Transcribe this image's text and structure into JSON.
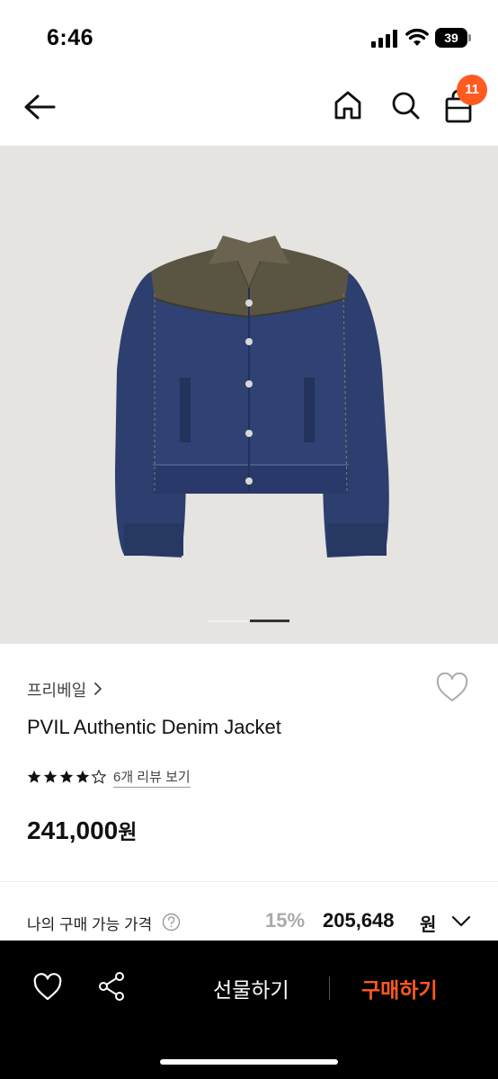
{
  "status_bar": {
    "time": "6:46",
    "battery": "39",
    "icons": [
      "cellular-signal-icon",
      "wifi-icon",
      "battery-icon"
    ]
  },
  "nav": {
    "icons": [
      "back-arrow-icon",
      "home-icon",
      "search-icon",
      "shopping-bag-icon"
    ],
    "cart_count": "11"
  },
  "hero": {
    "image": "denim-jacket-photo",
    "slide_index": 2,
    "slide_total": 2
  },
  "product": {
    "brand": "프리베일",
    "name": "PVIL Authentic Denim Jacket",
    "rating": 4.5,
    "rating_max": 5,
    "review_link": "6개 리뷰 보기",
    "price": "241,000",
    "price_unit": "원"
  },
  "my_price": {
    "label": "나의 구매 가능 가격",
    "discount": "15%",
    "price": "205,648",
    "unit": "원"
  },
  "bottom_bar": {
    "gift_label": "선물하기",
    "buy_label": "구매하기"
  },
  "colors": {
    "accent": "#ff5a1f",
    "bottom_bar_bg": "#000000",
    "hero_bg": "#e5e4e0",
    "discount_gray": "#aaaaaa"
  }
}
